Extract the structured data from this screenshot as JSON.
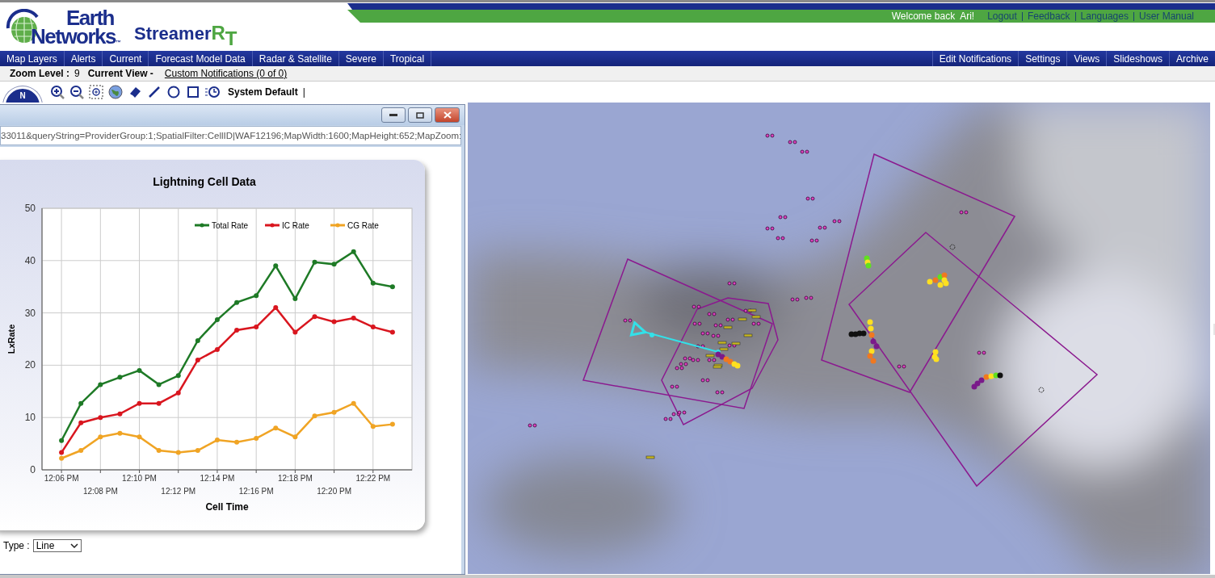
{
  "header": {
    "logo_line_1": "Earth",
    "logo_line_2": "Networks",
    "logo_mark": "™",
    "product": "Streamer",
    "product_suffix_1": "R",
    "product_suffix_2": "T",
    "welcome": "Welcome back  Ari!",
    "links": [
      "Logout",
      "Feedback",
      "Languages",
      "User Manual"
    ]
  },
  "nav_left": [
    {
      "label": "Map Layers"
    },
    {
      "label": "Alerts"
    },
    {
      "label": "Current"
    },
    {
      "label": "Forecast Model Data"
    },
    {
      "label": "Radar & Satellite"
    },
    {
      "label": "Severe"
    },
    {
      "label": "Tropical"
    }
  ],
  "nav_right": [
    {
      "label": "Edit Notifications"
    },
    {
      "label": "Settings"
    },
    {
      "label": "Views"
    },
    {
      "label": "Slideshows"
    },
    {
      "label": "Archive"
    }
  ],
  "info": {
    "zoom_label": "Zoom Level :",
    "zoom_value": "9",
    "view_label": "Current View -",
    "notifications_link": "Custom Notifications (0 of 0)"
  },
  "toolbar": {
    "compass_label": "N",
    "view_name": "System Default",
    "view_separator": "|"
  },
  "popup": {
    "url": "33011&queryString=ProviderGroup:1;SpatialFilter:CellID|WAF12196;MapWidth:1600;MapHeight:652;MapZoom:",
    "chart_data": {
      "type": "line",
      "title": "Lightning Cell Data",
      "xlabel": "Cell Time",
      "ylabel": "LxRate",
      "categories": [
        "12:06 PM",
        null,
        "12:08 PM",
        null,
        "12:10 PM",
        null,
        "12:12 PM",
        null,
        "12:14 PM",
        null,
        "12:16 PM",
        null,
        "12:18 PM",
        null,
        "12:20 PM",
        null,
        "12:22 PM",
        null
      ],
      "ylim": [
        0,
        50
      ],
      "yticks": [
        0,
        10,
        20,
        30,
        40,
        50
      ],
      "grid": true,
      "legend": true,
      "series": [
        {
          "name": "Total Rate",
          "color": "#1e7a26",
          "marker": "circle",
          "values": [
            5.6,
            12.7,
            16.3,
            17.7,
            19,
            16.3,
            18,
            24.7,
            28.7,
            32,
            33.3,
            39,
            32.7,
            39.7,
            39.3,
            41.7,
            35.7,
            35
          ]
        },
        {
          "name": "IC Rate",
          "color": "#d9161f",
          "marker": "circle",
          "values": [
            3.3,
            9,
            10,
            10.7,
            12.7,
            12.7,
            14.7,
            21,
            23,
            26.7,
            27.3,
            31,
            26.3,
            29.3,
            28.3,
            29,
            27.3,
            26.3
          ]
        },
        {
          "name": "CG Rate",
          "color": "#f0a424",
          "marker": "circle",
          "values": [
            2.2,
            3.7,
            6.3,
            7,
            6.3,
            3.7,
            3.3,
            3.7,
            5.7,
            5.3,
            6,
            8,
            6.3,
            10.3,
            11,
            12.7,
            8.3,
            8.7
          ]
        }
      ]
    },
    "chart_type_label": "Type :",
    "chart_type_value": "Line"
  }
}
